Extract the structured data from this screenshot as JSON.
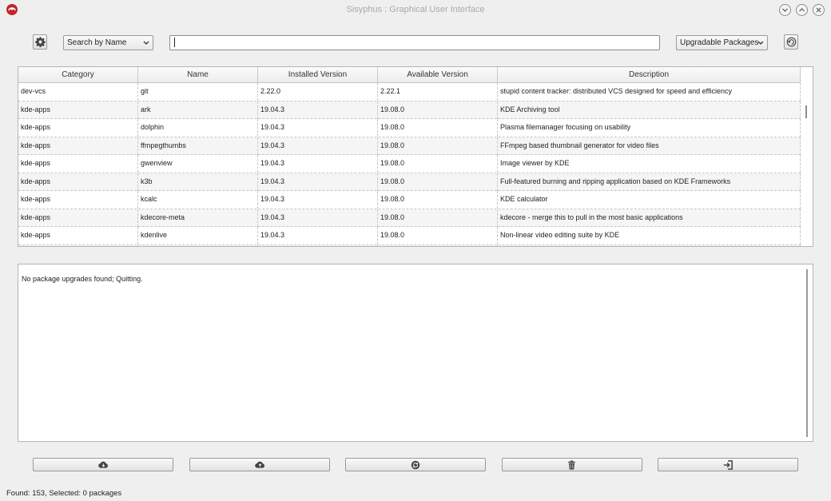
{
  "window": {
    "title": "Sisyphus : Graphical User Interface"
  },
  "toolbar": {
    "search_mode": "Search by Name",
    "search_value": "",
    "filter_mode": "Upgradable Packages"
  },
  "table": {
    "headers": [
      "Category",
      "Name",
      "Installed Version",
      "Available Version",
      "Description"
    ],
    "rows": [
      [
        "dev-vcs",
        "git",
        "2.22.0",
        "2.22.1",
        "stupid content tracker: distributed VCS designed for speed and efficiency"
      ],
      [
        "kde-apps",
        "ark",
        "19.04.3",
        "19.08.0",
        "KDE Archiving tool"
      ],
      [
        "kde-apps",
        "dolphin",
        "19.04.3",
        "19.08.0",
        "Plasma filemanager focusing on usability"
      ],
      [
        "kde-apps",
        "ffmpegthumbs",
        "19.04.3",
        "19.08.0",
        "FFmpeg based thumbnail generator for video files"
      ],
      [
        "kde-apps",
        "gwenview",
        "19.04.3",
        "19.08.0",
        "Image viewer by KDE"
      ],
      [
        "kde-apps",
        "k3b",
        "19.04.3",
        "19.08.0",
        "Full-featured burning and ripping application based on KDE Frameworks"
      ],
      [
        "kde-apps",
        "kcalc",
        "19.04.3",
        "19.08.0",
        "KDE calculator"
      ],
      [
        "kde-apps",
        "kdecore-meta",
        "19.04.3",
        "19.08.0",
        "kdecore - merge this to pull in the most basic applications"
      ],
      [
        "kde-apps",
        "kdenlive",
        "19.04.3",
        "19.08.0",
        "Non-linear video editing suite by KDE"
      ]
    ]
  },
  "log": {
    "text": "No package upgrades found; Quitting."
  },
  "status": {
    "text": "Found: 153, Selected: 0 packages"
  },
  "icons": {
    "app": "sisyphus-app-icon",
    "settings": "gear-icon",
    "refresh": "refresh-icon",
    "install": "cloud-download-icon",
    "uninstall": "cloud-upload-icon",
    "upgrade": "sync-icon",
    "clean": "trash-icon",
    "exit": "exit-icon"
  },
  "colors": {
    "app_icon": "#c0262b",
    "window_bg": "#efefef",
    "table_alt_row": "#f5f5f5"
  }
}
